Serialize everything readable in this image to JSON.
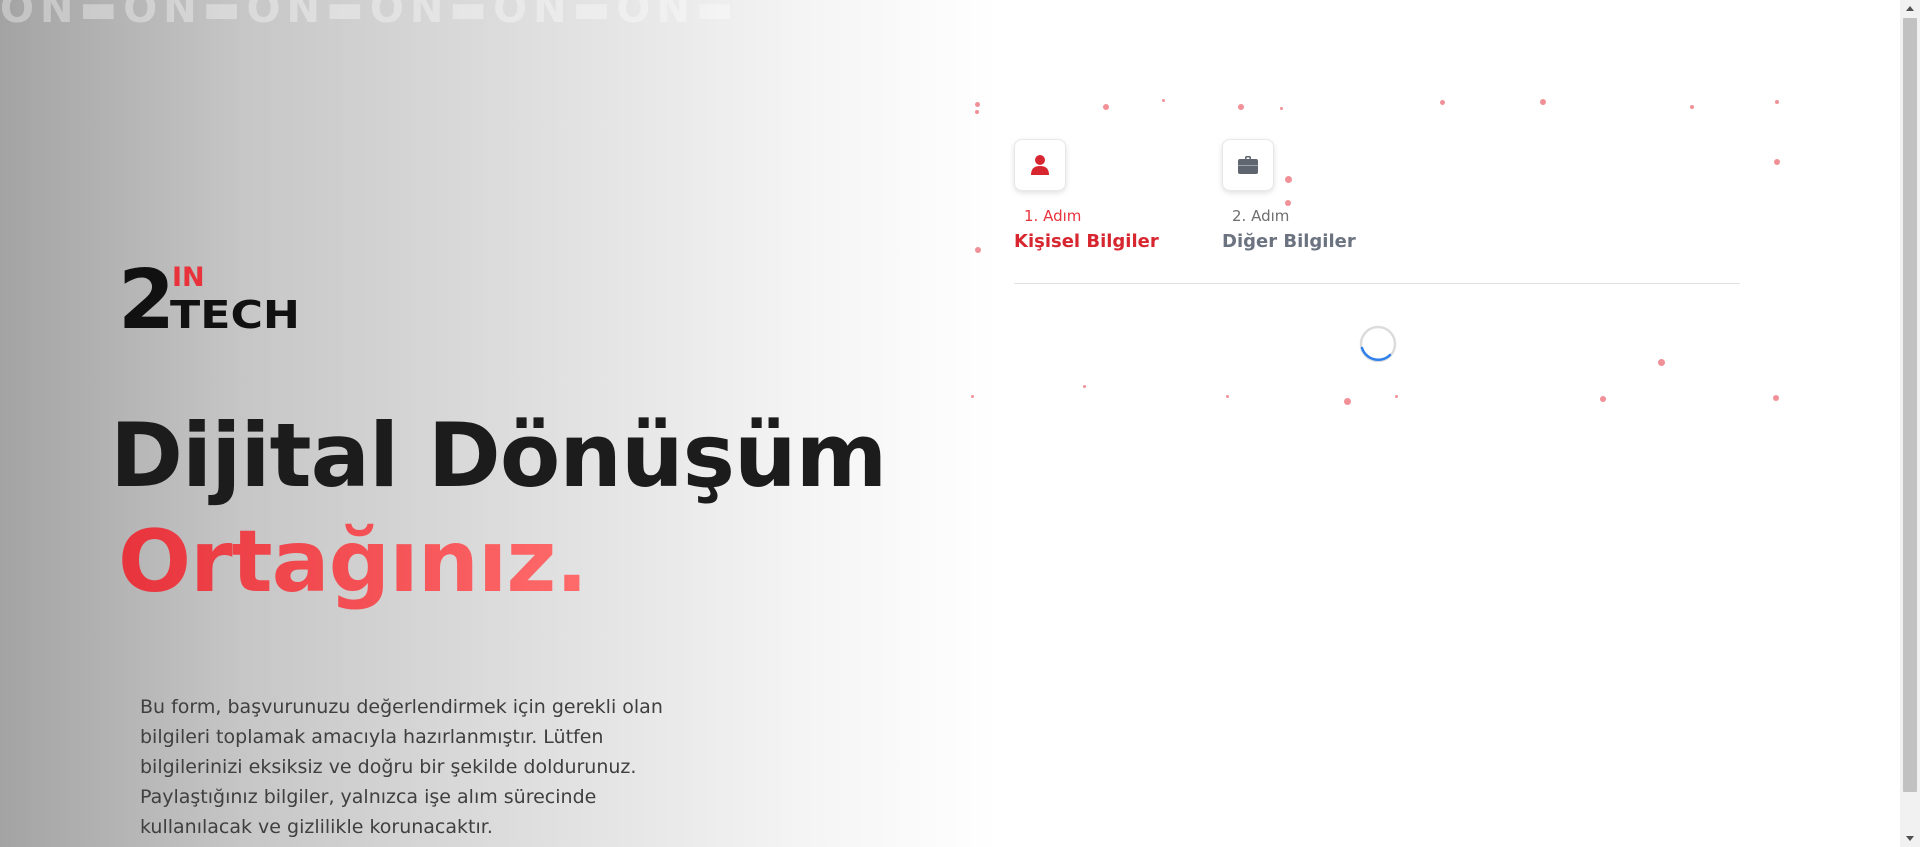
{
  "brand": {
    "logo_number": "2",
    "logo_top": "IN",
    "logo_bottom": "TECH",
    "watermark": "ON▬ON▬ON▬ON▬ON▬ON▬ON"
  },
  "hero": {
    "headline": "Dijital Dönüşüm",
    "headline_accent": "Ortağınız.",
    "description": "Bu form, başvurunuzu değerlendirmek için gerekli olan bilgileri toplamak amacıyla hazırlanmıştır. Lütfen bilgilerinizi eksiksiz ve doğru bir şekilde doldurunuz. Paylaştığınız bilgiler, yalnızca işe alım sürecinde kullanılacak ve gizlilikle korunacaktır."
  },
  "stepper": {
    "steps": [
      {
        "number": "1. Adım",
        "title": "Kişisel Bilgiler",
        "icon": "user-icon",
        "active": true
      },
      {
        "number": "2. Adım",
        "title": "Diğer Bilgiler",
        "icon": "briefcase-icon",
        "active": false
      }
    ]
  },
  "loading": {
    "icon": "loading-spinner-icon"
  },
  "colors": {
    "accent": "#e8333c",
    "accent_light": "#ff6b6b",
    "heading": "#1c1c1c",
    "inactive_step": "#6b7280",
    "spinner": "#2f80ed"
  }
}
